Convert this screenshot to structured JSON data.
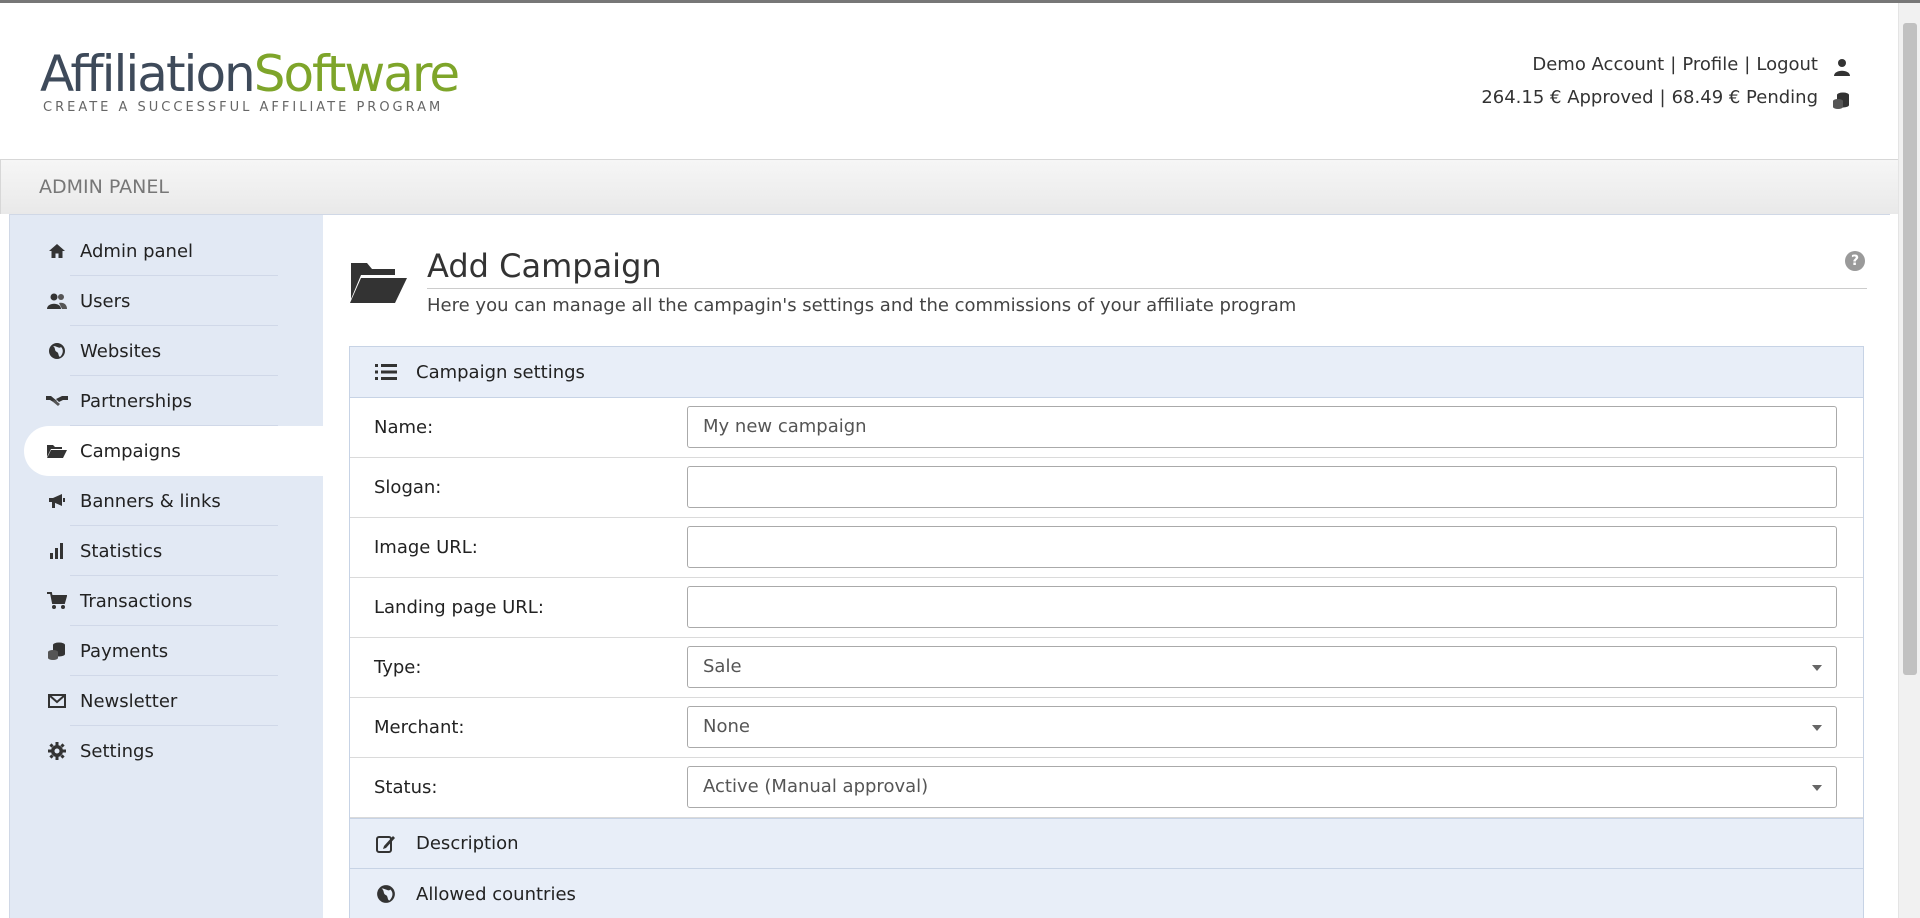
{
  "header": {
    "logo": {
      "part1": "Affiliation",
      "part2": "Software",
      "tagline": "CREATE A SUCCESSFUL AFFILIATE PROGRAM"
    },
    "user_links": {
      "account": "Demo Account",
      "sep1": "|",
      "profile": "Profile",
      "sep2": "|",
      "logout": "Logout"
    },
    "balance": {
      "approved": "264.15 € Approved",
      "sep": "|",
      "pending": "68.49 € Pending"
    }
  },
  "panel_title": "ADMIN PANEL",
  "sidebar": {
    "items": [
      {
        "label": "Admin panel",
        "icon": "home-icon"
      },
      {
        "label": "Users",
        "icon": "users-icon"
      },
      {
        "label": "Websites",
        "icon": "globe-icon"
      },
      {
        "label": "Partnerships",
        "icon": "handshake-icon"
      },
      {
        "label": "Campaigns",
        "icon": "folder-open-icon",
        "active": true
      },
      {
        "label": "Banners & links",
        "icon": "bullhorn-icon"
      },
      {
        "label": "Statistics",
        "icon": "bar-chart-icon"
      },
      {
        "label": "Transactions",
        "icon": "cart-icon"
      },
      {
        "label": "Payments",
        "icon": "coins-icon"
      },
      {
        "label": "Newsletter",
        "icon": "envelope-icon"
      },
      {
        "label": "Settings",
        "icon": "gear-icon"
      }
    ]
  },
  "page": {
    "title": "Add Campaign",
    "subtitle": "Here you can manage all the campagin's settings and the commissions of your affiliate program",
    "help": "?"
  },
  "form": {
    "section_title": "Campaign settings",
    "name": {
      "label": "Name:",
      "value": "My new campaign"
    },
    "slogan": {
      "label": "Slogan:",
      "value": ""
    },
    "image_url": {
      "label": "Image URL:",
      "value": ""
    },
    "landing_url": {
      "label": "Landing page URL:",
      "value": ""
    },
    "type": {
      "label": "Type:",
      "value": "Sale"
    },
    "merchant": {
      "label": "Merchant:",
      "value": "None"
    },
    "status": {
      "label": "Status:",
      "value": "Active (Manual approval)"
    }
  },
  "sections": {
    "description": "Description",
    "allowed_countries": "Allowed countries"
  },
  "colors": {
    "logo_dark": "#3e4a5a",
    "logo_green": "#7ea52a",
    "sidebar_bg": "#e2e9f4",
    "section_bg": "#e8eef8"
  }
}
